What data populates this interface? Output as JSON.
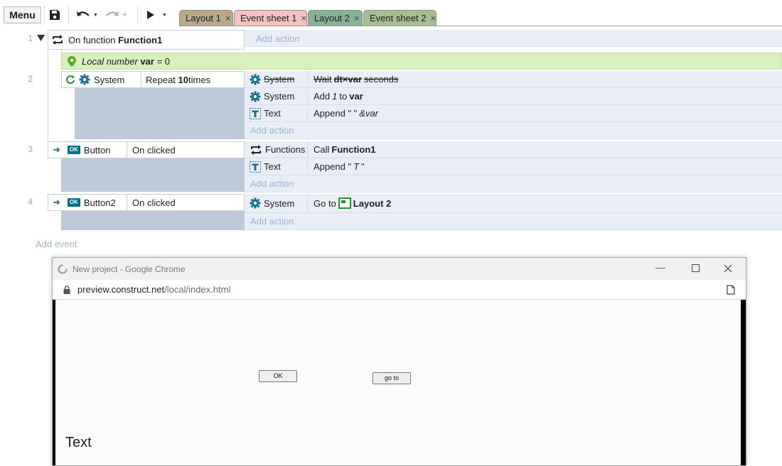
{
  "toolbar": {
    "menu_label": "Menu",
    "tabs": [
      {
        "label": "Layout 1",
        "color": "#b9a98a"
      },
      {
        "label": "Event sheet 1",
        "color": "#f4c2c2"
      },
      {
        "label": "Layout 2",
        "color": "#86b29a"
      },
      {
        "label": "Event sheet 2",
        "color": "#a9bd93"
      }
    ],
    "close_glyph": "×"
  },
  "events": {
    "add_action": "Add action",
    "add_event": "Add event",
    "e1": {
      "num": "1",
      "cond_prefix": "On function ",
      "cond_name": "Function1",
      "local_var_label": "Local number",
      "local_var_name": "var",
      "local_var_value": "= 0"
    },
    "e2": {
      "num": "2",
      "cond_object": "System",
      "cond_text_pre": "Repeat ",
      "cond_text_num": "10",
      "cond_text_post": " times",
      "actions": [
        {
          "object": "System",
          "text_pre": "Wait ",
          "text_bold": "dt×var",
          "text_post": " seconds"
        },
        {
          "object": "System",
          "text_pre": "Add ",
          "text_italic": "1",
          "text_mid": " to ",
          "text_bold": "var"
        },
        {
          "object": "Text",
          "text_pre": "Append \" \"",
          "text_italic": "&var"
        }
      ]
    },
    "e3": {
      "num": "3",
      "cond_object": "Button",
      "cond_text": "On clicked",
      "actions": [
        {
          "object": "Functions",
          "text_pre": "Call ",
          "text_bold": "Function1"
        },
        {
          "object": "Text",
          "text_pre": "Append \"",
          "text_italic": "T",
          "text_post": "\""
        }
      ]
    },
    "e4": {
      "num": "4",
      "cond_object": "Button2",
      "cond_text": "On clicked",
      "actions": [
        {
          "object": "System",
          "text_pre": "Go to ",
          "text_bold": "Layout 2"
        }
      ]
    },
    "ok_badge": "OK"
  },
  "chrome": {
    "title": "New project - Google Chrome",
    "url_host": "preview.construct.net",
    "url_path": "/local/index.html",
    "canvas": {
      "ok_button": "OK",
      "goto_button": "go to",
      "text_object": "Text"
    }
  }
}
